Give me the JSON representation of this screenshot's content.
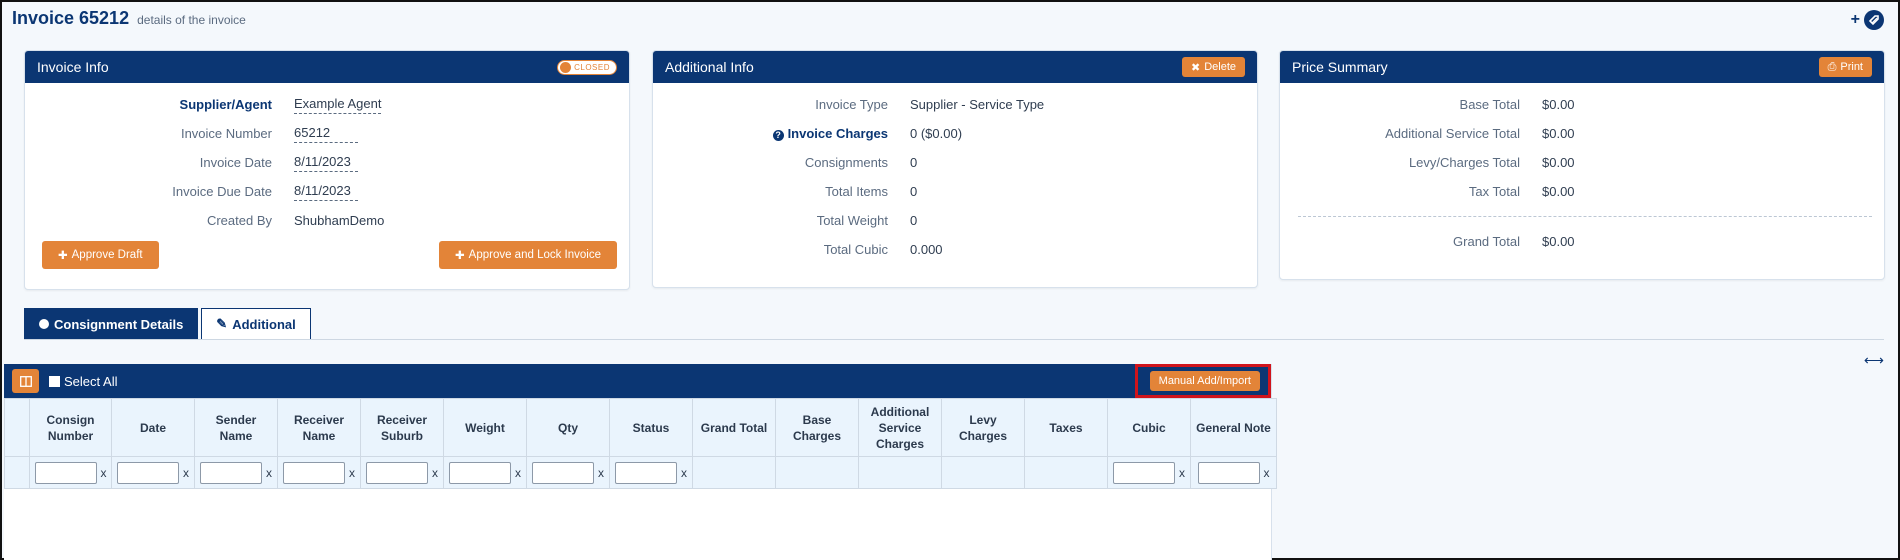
{
  "page": {
    "title": "Invoice 65212",
    "subtitle": "details of the invoice"
  },
  "invoice_info": {
    "title": "Invoice Info",
    "status_badge": "CLOSED",
    "rows": [
      {
        "label": "Supplier/Agent",
        "value": "Example Agent"
      },
      {
        "label": "Invoice Number",
        "value": "65212"
      },
      {
        "label": "Invoice Date",
        "value": "8/11/2023"
      },
      {
        "label": "Invoice Due Date",
        "value": "8/11/2023"
      },
      {
        "label": "Created By",
        "value": "ShubhamDemo"
      }
    ],
    "approve_draft": "Approve Draft",
    "approve_lock": "Approve and Lock Invoice"
  },
  "additional_info": {
    "title": "Additional Info",
    "delete_label": "Delete",
    "rows": [
      {
        "label": "Invoice Type",
        "value": "Supplier - Service Type"
      },
      {
        "label": "Invoice Charges",
        "value": "0 ($0.00)"
      },
      {
        "label": "Consignments",
        "value": "0"
      },
      {
        "label": "Total Items",
        "value": "0"
      },
      {
        "label": "Total Weight",
        "value": "0"
      },
      {
        "label": "Total Cubic",
        "value": "0.000"
      }
    ]
  },
  "price_summary": {
    "title": "Price Summary",
    "print_label": "Print",
    "rows": [
      {
        "label": "Base Total",
        "value": "$0.00"
      },
      {
        "label": "Additional Service Total",
        "value": "$0.00"
      },
      {
        "label": "Levy/Charges Total",
        "value": "$0.00"
      },
      {
        "label": "Tax Total",
        "value": "$0.00"
      }
    ],
    "grand_label": "Grand Total",
    "grand_value": "$0.00"
  },
  "tabs": [
    {
      "label": "Consignment Details"
    },
    {
      "label": "Additional"
    }
  ],
  "grid": {
    "select_all": "Select All",
    "manual_add": "Manual Add/Import",
    "clear_symbol": "x",
    "columns": [
      {
        "label": "Consign Number"
      },
      {
        "label": "Date"
      },
      {
        "label": "Sender Name"
      },
      {
        "label": "Receiver Name"
      },
      {
        "label": "Receiver Suburb"
      },
      {
        "label": "Weight"
      },
      {
        "label": "Qty"
      },
      {
        "label": "Status"
      },
      {
        "label": "Grand Total"
      },
      {
        "label": "Base Charges"
      },
      {
        "label": "Additional Service Charges"
      },
      {
        "label": "Levy Charges"
      },
      {
        "label": "Taxes"
      },
      {
        "label": "Cubic"
      },
      {
        "label": "General Note"
      }
    ]
  },
  "colors": {
    "navy": "#0b3673",
    "orange": "#e38438",
    "highlight": "#d0141c"
  }
}
